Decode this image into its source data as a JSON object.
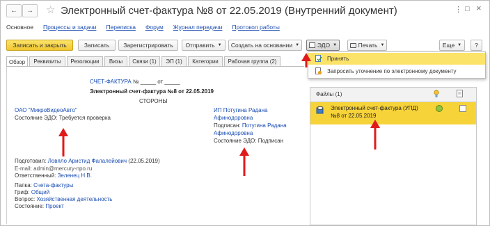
{
  "window": {
    "title": "Электронный счет-фактура №8 от 22.05.2019 (Внутренний документ)",
    "back": "←",
    "forward": "→",
    "star": "☆",
    "menu_icon": "⋮",
    "maximize_icon": "□",
    "close_icon": "×"
  },
  "nav_links": {
    "current": "Основное",
    "links": [
      "Процессы и задачи",
      "Переписка",
      "Форум",
      "Журнал передачи",
      "Протокол работы"
    ]
  },
  "toolbar": {
    "save_close": "Записать и закрыть",
    "save": "Записать",
    "register": "Зарегистрировать",
    "send": "Отправить",
    "create_based": "Создать на основании",
    "edo": "ЭДО",
    "print": "Печать",
    "more": "Еще",
    "help": "?"
  },
  "edo_menu": {
    "items": [
      "Принять",
      "Запросить уточнение по электронному документу"
    ]
  },
  "tabs": [
    "Обзор",
    "Реквизиты",
    "Резолюции",
    "Визы",
    "Связи (1)",
    "ЭП (1)",
    "Категории",
    "Рабочая группа (2)"
  ],
  "document": {
    "header_prefix": "СЧЕТ-ФАКТУРА",
    "header_num": "№ _____ от _____",
    "heading": "Электронный счет-фактура №8 от 22.05.2019",
    "sides_label": "СТОРОНЫ",
    "left_party": {
      "name": "ОАО \"МикроВидеоАвто\"",
      "edo_label": "Состояние ЭДО: Требуется проверка"
    },
    "right_party": {
      "name_line1": "ИП Потугина Радана",
      "name_line2": "Афинодоровна",
      "signed_label": "Подписан:",
      "signed_line1": "Потугина Радана",
      "signed_line2": "Афинодоровна",
      "edo_label": "Состояние ЭДО: Подписан"
    },
    "prepared_label": "Подготовил:",
    "prepared_value": "Ловяло Аристид Фалалейович",
    "prepared_date": "(22.05.2019)",
    "email": "E-mail: admin@mercury-npo.ru",
    "responsible_label": "Ответственный:",
    "responsible_value": "Зеленец Н.В.",
    "folder_label": "Папка:",
    "folder_value": "Счета-фактуры",
    "grif_label": "Гриф:",
    "grif_value": "Общий",
    "question_label": "Вопрос:",
    "question_value": "Хозяйственная деятельность",
    "state_label": "Состояние:",
    "state_value": "Проект"
  },
  "files": {
    "header": "Файлы (1)",
    "row_line1": "Электронный счет-фактура (УПД)",
    "row_line2": "№8 от 22.05.2019"
  },
  "colors": {
    "accent_yellow": "#f7d33a",
    "link_blue": "#1a4db3",
    "arrow_red": "#e01a1a",
    "status_green": "#8fc43c"
  }
}
